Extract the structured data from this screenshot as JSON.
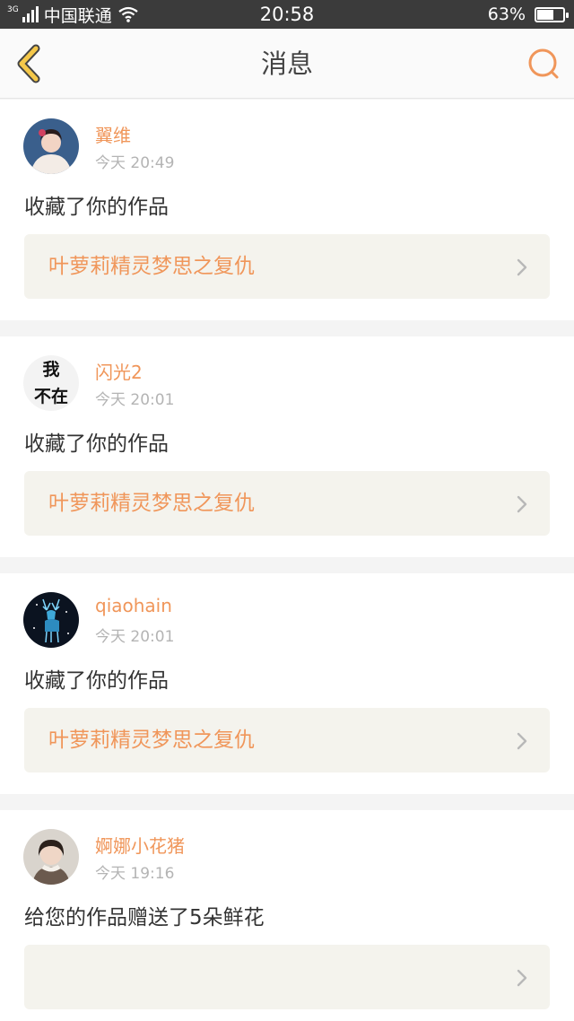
{
  "status_bar": {
    "network": "3G",
    "carrier": "中国联通",
    "time": "20:58",
    "battery": "63%",
    "battery_level": 0.63
  },
  "nav": {
    "title": "消息",
    "back_icon": "chevron-left-icon",
    "search_icon": "search-icon"
  },
  "messages": [
    {
      "username": "翼维",
      "time": "今天 20:49",
      "action": "收藏了你的作品",
      "work_title": "叶萝莉精灵梦思之复仇",
      "avatar": "woman-portrait"
    },
    {
      "username": "闪光2",
      "time": "今天 20:01",
      "action": "收藏了你的作品",
      "work_title": "叶萝莉精灵梦思之复仇",
      "avatar_text_1": "我",
      "avatar_text_2": "不在"
    },
    {
      "username": "qiaohain",
      "time": "今天 20:01",
      "action": "收藏了你的作品",
      "work_title": "叶萝莉精灵梦思之复仇",
      "avatar": "glowing-deer"
    },
    {
      "username": "婀娜小花猪",
      "time": "今天 19:16",
      "action": "给您的作品赠送了5朵鲜花",
      "work_title": "",
      "avatar": "child-portrait"
    }
  ],
  "colors": {
    "accent": "#f0965a",
    "back_icon": "#f5c84a",
    "link_bg": "#f4f3ed"
  }
}
